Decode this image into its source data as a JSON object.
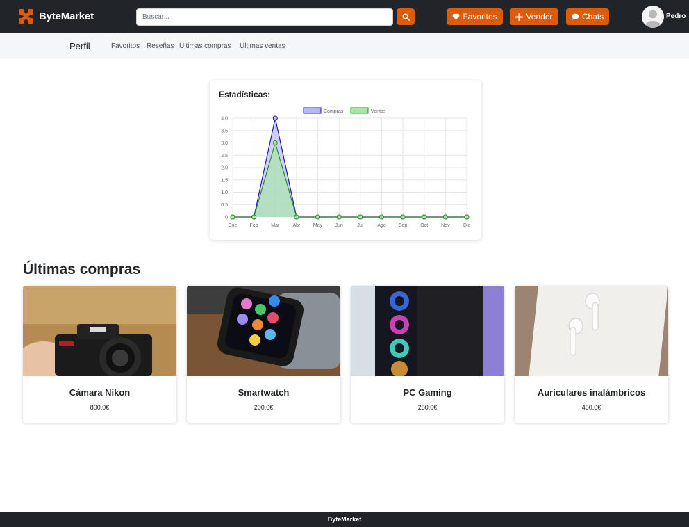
{
  "brand": {
    "name": "ByteMarket",
    "color": "#dc5b0c"
  },
  "search": {
    "placeholder": "Buscar..."
  },
  "nav": {
    "favorites_label": "Favoritos",
    "sell_label": "Vender",
    "chats_label": "Chats",
    "user_name": "Pedro"
  },
  "subnav": {
    "title": "Perfil",
    "links": [
      "Favoritos",
      "Reseñas",
      "Últimas compras",
      "Últimas ventas"
    ]
  },
  "stats": {
    "title": "Estadísticas:"
  },
  "chart_data": {
    "type": "line",
    "categories": [
      "Ene",
      "Feb",
      "Mar",
      "Abr",
      "May",
      "Jun",
      "Jul",
      "Ago",
      "Sep",
      "Oct",
      "Nov",
      "Dic"
    ],
    "series": [
      {
        "name": "Compras",
        "values": [
          0,
          0,
          4,
          0,
          0,
          0,
          0,
          0,
          0,
          0,
          0,
          0
        ],
        "color": "#1a1aaa",
        "fill": "#b4b9f0"
      },
      {
        "name": "Ventas",
        "values": [
          0,
          0,
          3,
          0,
          0,
          0,
          0,
          0,
          0,
          0,
          0,
          0
        ],
        "color": "#2e8b2e",
        "fill": "#a8e6a8"
      }
    ],
    "yticks": [
      "0",
      "0.5",
      "1.0",
      "1.5",
      "2.0",
      "2.5",
      "3.0",
      "3.5",
      "4.0"
    ],
    "ylim": [
      0,
      4
    ],
    "legend": "top",
    "grid": true,
    "area": true
  },
  "purchases": {
    "title": "Últimas compras",
    "items": [
      {
        "name": "Cámara Nikon",
        "price": "800.0€"
      },
      {
        "name": "Smartwatch",
        "price": "200.0€"
      },
      {
        "name": "PC Gaming",
        "price": "250.0€"
      },
      {
        "name": "Auriculares inalámbricos",
        "price": "450.0€"
      }
    ]
  },
  "footer": {
    "text": "ByteMarket"
  }
}
